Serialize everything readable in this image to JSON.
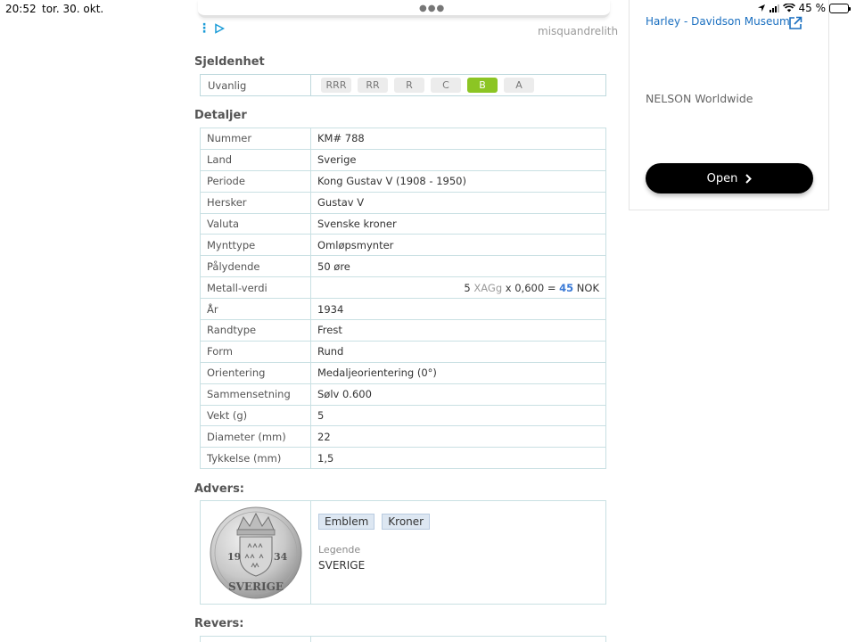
{
  "status_bar": {
    "time": "20:52",
    "date": "tor. 30. okt.",
    "battery": "45 %",
    "battery_level": 0.45
  },
  "ad": {
    "advertiser": "misquandrelith"
  },
  "side_ad": {
    "link": "Harley - Davidson Museum",
    "subtitle": "NELSON Worldwide",
    "button": "Open"
  },
  "rarity": {
    "title": "Sjeldenhet",
    "label": "Uvanlig",
    "grades": [
      "RRR",
      "RR",
      "R",
      "C",
      "B",
      "A"
    ],
    "selected": "B"
  },
  "details": {
    "title": "Detaljer",
    "rows": [
      {
        "key": "Nummer",
        "value": "KM# 788"
      },
      {
        "key": "Land",
        "value": "Sverige"
      },
      {
        "key": "Periode",
        "value": "Kong Gustav V (1908 - 1950)"
      },
      {
        "key": "Hersker",
        "value": "Gustav V"
      },
      {
        "key": "Valuta",
        "value": "Svenske kroner"
      },
      {
        "key": "Mynttype",
        "value": "Omløpsmynter"
      },
      {
        "key": "Pålydende",
        "value": "50 øre"
      },
      {
        "key": "Metall-verdi",
        "metal": {
          "qty": "5",
          "unit": "XAGg",
          "factor": "x 0,600 =",
          "result": "45",
          "currency": "NOK"
        }
      },
      {
        "key": "År",
        "value": "1934"
      },
      {
        "key": "Randtype",
        "value": "Frest"
      },
      {
        "key": "Form",
        "value": "Rund"
      },
      {
        "key": "Orientering",
        "value": "Medaljeorientering (0°)"
      },
      {
        "key": "Sammensetning",
        "value": "Sølv 0.600"
      },
      {
        "key": "Vekt (g)",
        "value": "5"
      },
      {
        "key": "Diameter (mm)",
        "value": "22"
      },
      {
        "key": "Tykkelse (mm)",
        "value": "1,5"
      }
    ]
  },
  "avers": {
    "title": "Advers:",
    "tags": [
      "Emblem",
      "Kroner"
    ],
    "legend_label": "Legende",
    "legend_value": "SVERIGE",
    "coin_text": {
      "left": "19",
      "right": "34",
      "bottom": "SVERIGE"
    }
  },
  "revers": {
    "title": "Revers:"
  }
}
